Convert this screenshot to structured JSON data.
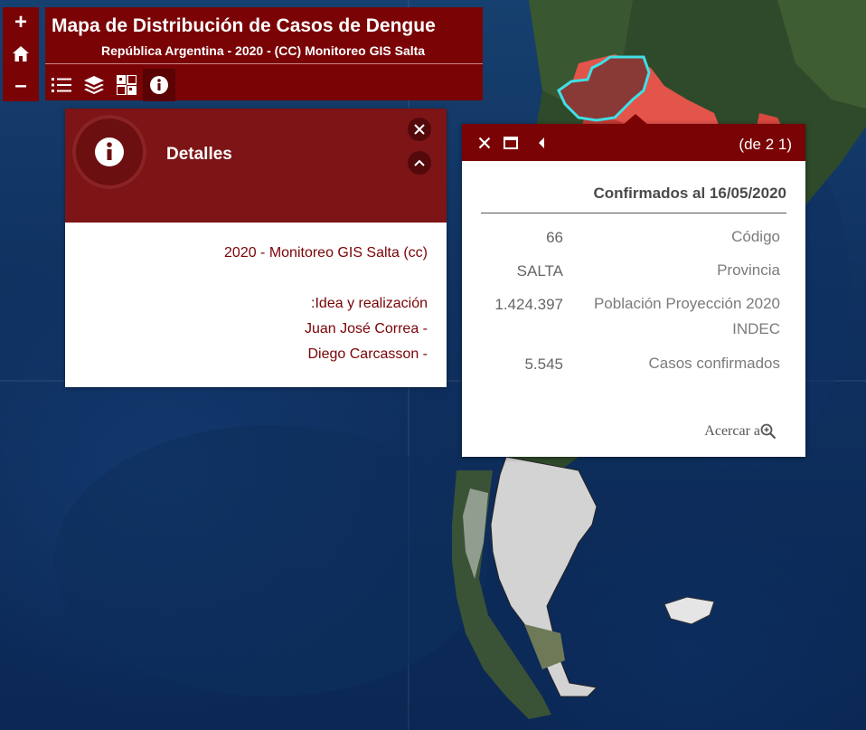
{
  "map": {
    "ocean_color": "#0f3160",
    "land_color": "#1f3b22",
    "province_gray": "#d3d3d3",
    "province_highlight": "#e3544a",
    "selection_outline": "#3fe0e6"
  },
  "nav": {
    "zoom_in": "+",
    "home_icon": "home-icon",
    "zoom_out": "–"
  },
  "title_panel": {
    "title": "Mapa de Distribución de Casos de Dengue",
    "subtitle": "República Argentina - 2020 - (CC) Monitoreo GIS Salta",
    "tools": [
      "list-icon",
      "layers-icon",
      "basemap-icon",
      "info-icon"
    ]
  },
  "details": {
    "title": "Detalles",
    "lines": [
      "2020 - Monitoreo GIS Salta (cc)",
      ":Idea y realización",
      "Juan José Correa -",
      "Diego Carcasson -"
    ]
  },
  "popup": {
    "count": "(de 2 1)",
    "title": "Confirmados al 16/05/2020",
    "rows": [
      {
        "value": "66",
        "label": "Código"
      },
      {
        "value": "SALTA",
        "label": "Provincia"
      },
      {
        "value": "1.424.397",
        "label": "Población Proyección 2020 INDEC"
      },
      {
        "value": "5.545",
        "label": "Casos confirmados"
      }
    ],
    "zoom_to": "Acercar a"
  },
  "colors": {
    "brand": "#7a0306",
    "brand_header": "#7d1416",
    "text_red": "#7a0306"
  }
}
